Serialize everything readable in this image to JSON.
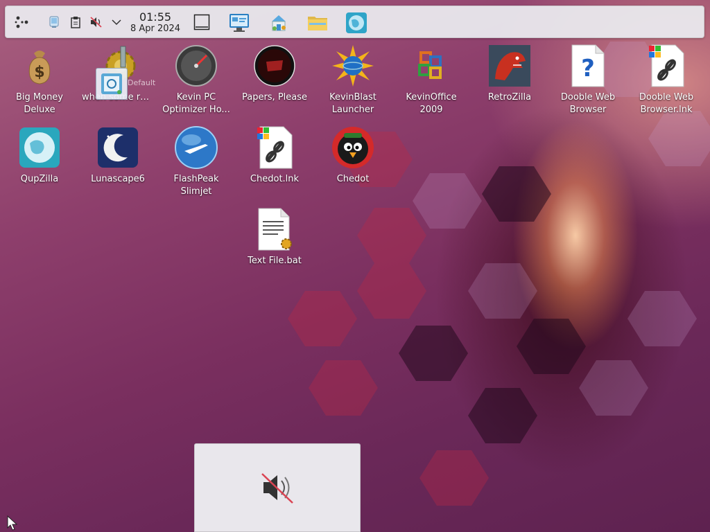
{
  "panel": {
    "launcher_icon": "application-launcher-icon",
    "tray": [
      {
        "name": "tray-network-icon"
      },
      {
        "name": "tray-clipboard-icon"
      },
      {
        "name": "tray-volume-muted-icon"
      },
      {
        "name": "tray-expand-chevron-icon"
      }
    ],
    "clock": {
      "time": "01:55",
      "date": "8 Apr 2024"
    },
    "show_desktop_icon": "show-desktop-icon",
    "tasks": [
      {
        "name": "task-system-settings"
      },
      {
        "name": "task-store"
      },
      {
        "name": "task-file-manager"
      },
      {
        "name": "task-browser"
      }
    ]
  },
  "desktop": {
    "icons": [
      {
        "label": "Big Money Deluxe",
        "icon": "money-bag-icon"
      },
      {
        "label": "when some russian runs a...",
        "icon": "gear-icon"
      },
      {
        "label": "Kevin PC Optimizer Ho...",
        "icon": "gauge-icon"
      },
      {
        "label": "Papers, Please",
        "icon": "papers-please-icon"
      },
      {
        "label": "KevinBlast Launcher",
        "icon": "burst-globe-icon"
      },
      {
        "label": "KevinOffice 2009",
        "icon": "office-icon"
      },
      {
        "label": "RetroZilla",
        "icon": "dinosaur-icon"
      },
      {
        "label": "Dooble Web Browser",
        "icon": "unknown-file-icon"
      },
      {
        "label": "Dooble Web Browser.lnk",
        "icon": "shortcut-file-icon"
      },
      {
        "label": "QupZilla",
        "icon": "globe-icon"
      },
      {
        "label": "Lunascape6",
        "icon": "moon-icon"
      },
      {
        "label": "FlashPeak Slimjet",
        "icon": "jet-globe-icon"
      },
      {
        "label": "Chedot.lnk",
        "icon": "shortcut-file-icon"
      },
      {
        "label": "Chedot",
        "icon": "bird-icon"
      },
      {
        "label": "Text File.bat",
        "icon": "batch-file-icon"
      }
    ],
    "drag_label": "Default"
  },
  "osd": {
    "icon": "volume-muted-icon"
  },
  "colors": {
    "accent": "#3daee9",
    "panel": "#ebecf0"
  }
}
